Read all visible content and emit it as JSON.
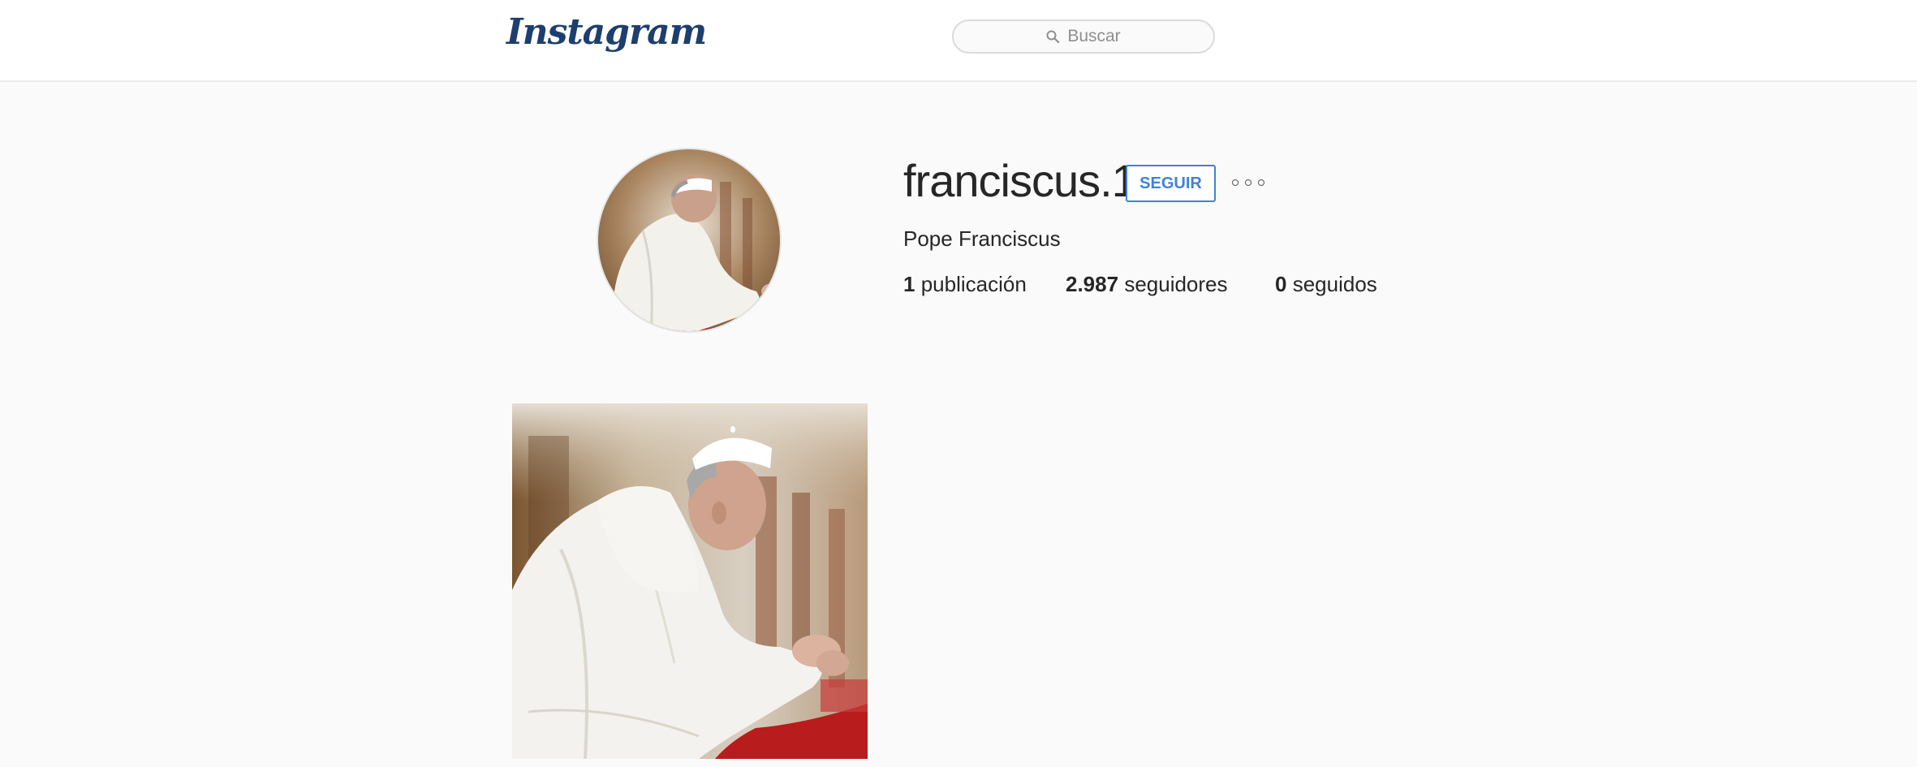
{
  "header": {
    "logo_text": "Instagram",
    "search": {
      "placeholder": "Buscar",
      "icon": "search-icon"
    }
  },
  "profile": {
    "username": "franciscus.1",
    "follow_label": "SEGUIR",
    "more_icon": "more-options-icon",
    "full_name": "Pope Franciscus",
    "stats": {
      "posts": {
        "count": "1",
        "label": "publicación"
      },
      "followers": {
        "count": "2.987",
        "label": "seguidores"
      },
      "following": {
        "count": "0",
        "label": "seguidos"
      }
    }
  },
  "posts": [
    {
      "icon": "photo-praying-pope"
    }
  ],
  "colors": {
    "accent": "#3f82d8",
    "logo": "#1c3f6e",
    "background": "#fafafa",
    "text": "#262626"
  }
}
